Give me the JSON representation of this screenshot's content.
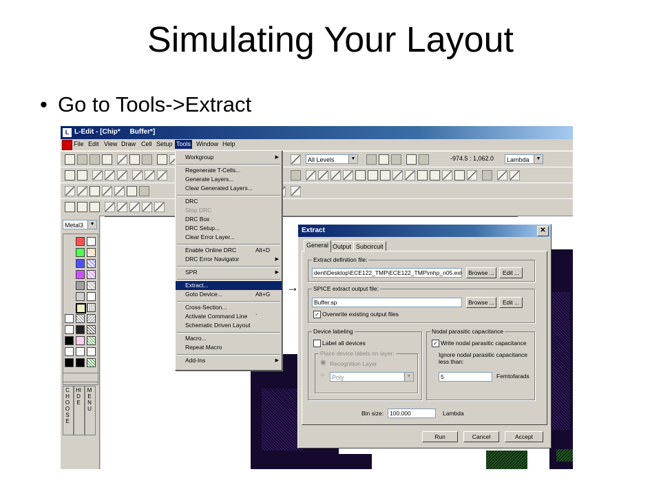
{
  "slide": {
    "title": "Simulating Your Layout",
    "bullet": "Go to Tools->Extract"
  },
  "window": {
    "title": "L-Edit - [Chip*     Buffer*]",
    "app_icon": "ledit-app-icon"
  },
  "menubar": {
    "items": [
      "File",
      "Edit",
      "View",
      "Draw",
      "Cell",
      "Setup",
      "Tools",
      "Window",
      "Help"
    ],
    "active": "Tools"
  },
  "toolbar": {
    "levels_combo": "All Levels",
    "coords": "-974.5 : 1,062.0",
    "units_combo": "Lambda"
  },
  "layer_combo": "Metal3",
  "side_tabs": {
    "choose": "CHOOSE",
    "hide": "HIDE",
    "menu": "MENU"
  },
  "tools_menu": {
    "items": [
      {
        "label": "Workgroup",
        "shortcut": "",
        "submenu": true,
        "disabled": false
      },
      {
        "label": "Regenerate T-Cells...",
        "shortcut": "",
        "submenu": false,
        "disabled": false
      },
      {
        "label": "Generate Layers...",
        "shortcut": "",
        "submenu": false,
        "disabled": false
      },
      {
        "label": "Clear Generated Layers...",
        "shortcut": "",
        "submenu": false,
        "disabled": false
      },
      {
        "label": "DRC",
        "shortcut": "",
        "submenu": false,
        "disabled": false
      },
      {
        "label": "Stop DRC",
        "shortcut": "",
        "submenu": false,
        "disabled": true
      },
      {
        "label": "DRC Box",
        "shortcut": "",
        "submenu": false,
        "disabled": false
      },
      {
        "label": "DRC Setup...",
        "shortcut": "",
        "submenu": false,
        "disabled": false
      },
      {
        "label": "Clear Error Layer...",
        "shortcut": "",
        "submenu": false,
        "disabled": false
      },
      {
        "label": "Enable Online DRC",
        "shortcut": "Alt+D",
        "submenu": false,
        "disabled": false
      },
      {
        "label": "DRC Error Navigator",
        "shortcut": "",
        "submenu": true,
        "disabled": false
      },
      {
        "label": "SPR",
        "shortcut": "",
        "submenu": true,
        "disabled": false
      },
      {
        "label": "Extract...",
        "shortcut": "",
        "submenu": false,
        "disabled": false
      },
      {
        "label": "Goto Device...",
        "shortcut": "Alt+G",
        "submenu": false,
        "disabled": false
      },
      {
        "label": "Cross-Section...",
        "shortcut": "",
        "submenu": false,
        "disabled": false
      },
      {
        "label": "Activate Command Line",
        "shortcut": "`",
        "submenu": false,
        "disabled": false
      },
      {
        "label": "Schematic Driven Layout",
        "shortcut": "",
        "submenu": false,
        "disabled": false
      },
      {
        "label": "Macro...",
        "shortcut": "",
        "submenu": false,
        "disabled": false
      },
      {
        "label": "Repeat Macro",
        "shortcut": "",
        "submenu": false,
        "disabled": false
      },
      {
        "label": "Add-Ins",
        "shortcut": "",
        "submenu": true,
        "disabled": false
      }
    ],
    "highlighted": "Extract..."
  },
  "extract_dialog": {
    "title": "Extract",
    "close": "✕",
    "tabs": [
      "General",
      "Output",
      "Subcircuit"
    ],
    "active_tab": "General",
    "definition_file": {
      "group_label": "Extract definition file:",
      "value": "dent\\Desktop\\ECE122_TMP\\ECE122_TMP\\mhp_n05.ext",
      "browse": "Browse ...",
      "edit": "Edit ..."
    },
    "spice_file": {
      "group_label": "SPICE extract output file:",
      "value": "Buffer.sp",
      "browse": "Browse ...",
      "edit": "Edit ...",
      "overwrite_label": "Overwrite existing output files",
      "overwrite_checked": true
    },
    "device_labeling": {
      "group_label": "Device labeling",
      "label_all": "Label all devices",
      "label_all_checked": false,
      "place_group_label": "Place device labels on layer:",
      "recognition_layer": "Recognition Layer",
      "poly": "Poly"
    },
    "nodal": {
      "group_label": "Nodal parasitic capacitance",
      "write_label": "Write nodal parasitic capacitance",
      "write_checked": true,
      "ignore_label": "Ignore nodal parasitic capacitance less than:",
      "value": "5",
      "units": "Femtofarads"
    },
    "bin_size": {
      "label": "Bin size:",
      "value": "100.000",
      "units": "Lambda"
    },
    "buttons": {
      "run": "Run",
      "cancel": "Cancel",
      "accept": "Accept"
    }
  },
  "colors": {
    "titlebar": "#0a246a",
    "highlight": "#0a246a",
    "chrome": "#d4d0c8",
    "layout_dark": "#150a2e"
  }
}
